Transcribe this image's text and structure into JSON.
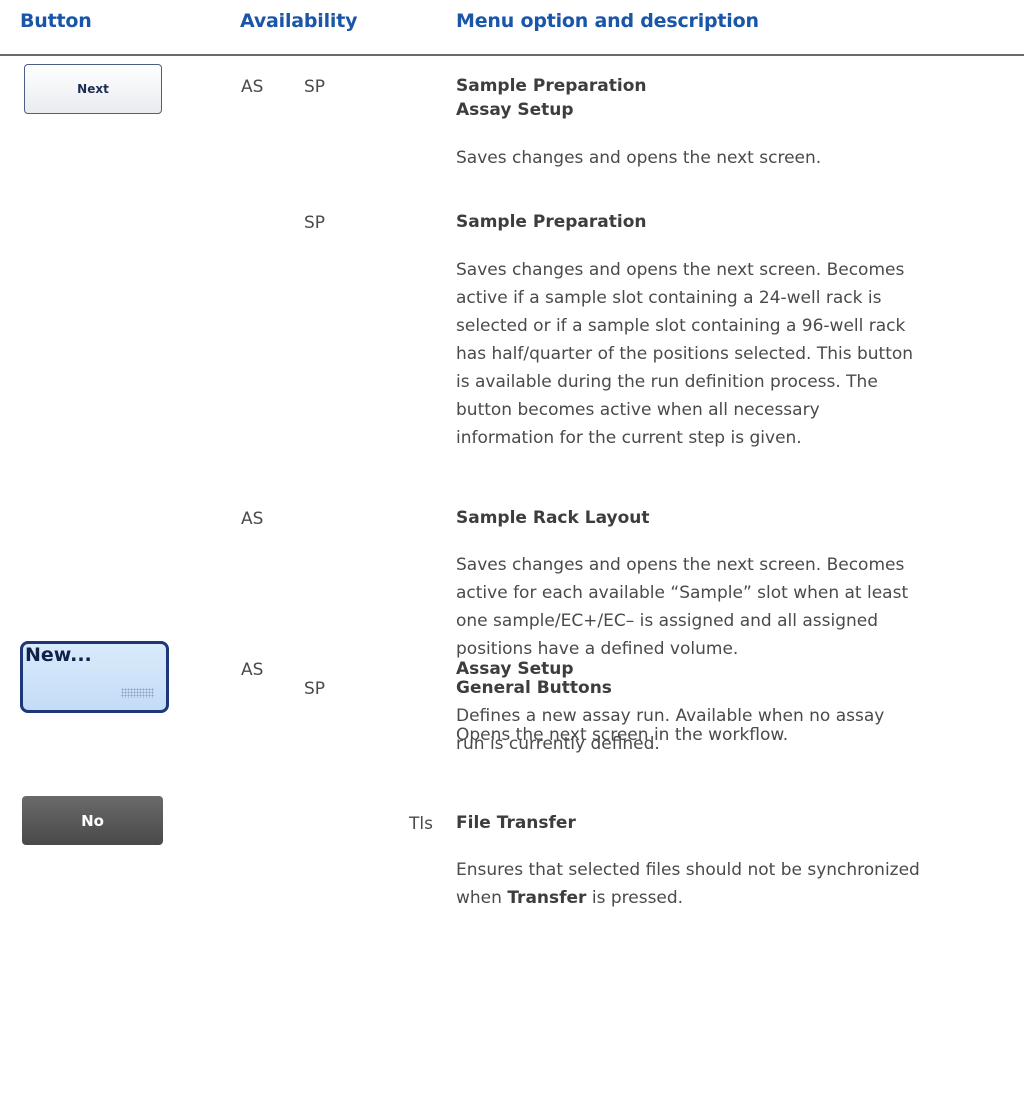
{
  "header": {
    "button": "Button",
    "availability": "Availability",
    "menu": "Menu option and description"
  },
  "buttons": {
    "next_label": "Next",
    "new_label": "New...",
    "no_label": "No"
  },
  "rows": [
    {
      "avail_1": "AS",
      "avail_2": "SP",
      "title_1": "Sample Preparation",
      "title_2": "Assay Setup",
      "desc": "Saves changes and opens the next screen."
    },
    {
      "avail": "SP",
      "title": "Sample Preparation",
      "desc_lines": [
        "Saves changes and opens the next screen. Becomes",
        "active if a sample slot containing a 24-well rack is",
        "selected or if a sample slot containing a 96-well rack",
        "has half/quarter of the positions selected. This button",
        "is available during the run definition process. The",
        "button becomes active when all necessary",
        "information for the current step is given."
      ]
    },
    {
      "avail": "AS",
      "title": "Sample Rack Layout",
      "desc_lines": [
        "Saves changes and opens the next screen. Becomes",
        "active for each available “Sample” slot when at least",
        "one sample/EC+/EC– is assigned and all assigned",
        "positions have a defined volume."
      ]
    },
    {
      "avail": "SP",
      "title": "General Buttons",
      "desc": "Opens the next screen in the workflow."
    },
    {
      "avail": "AS",
      "title": "Assay Setup",
      "desc_lines": [
        "Defines a new assay run. Available when no assay",
        "run is currently defined."
      ]
    },
    {
      "avail": "Tls",
      "title": "File Transfer",
      "desc_line_1": "Ensures that selected files should not be synchronized",
      "desc_line_2_pre": "when ",
      "desc_line_2_bold": "Transfer",
      "desc_line_2_post": " is pressed."
    }
  ]
}
